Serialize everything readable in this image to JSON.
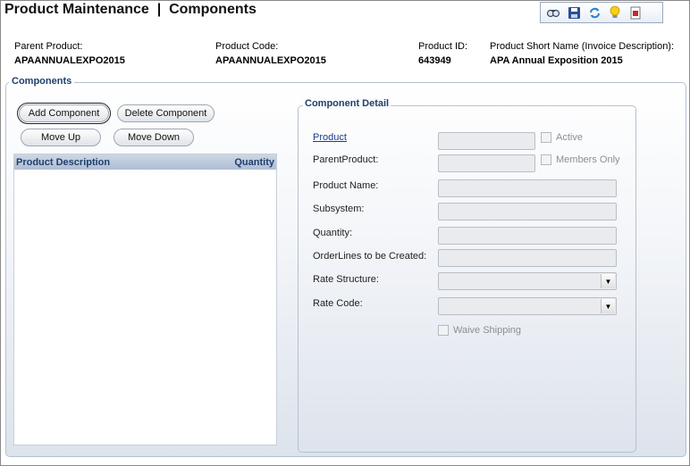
{
  "title": "Product Maintenance  |  Components",
  "toolbar": {
    "icons": [
      "find-icon",
      "save-icon",
      "refresh-icon",
      "help-bulb-icon",
      "report-icon"
    ]
  },
  "header": {
    "parent_product_label": "Parent Product:",
    "parent_product_value": "APAANNUALEXPO2015",
    "product_code_label": "Product Code:",
    "product_code_value": "APAANNUALEXPO2015",
    "product_id_label": "Product ID:",
    "product_id_value": "643949",
    "short_name_label": "Product Short Name (Invoice Description):",
    "short_name_value": "APA Annual Exposition 2015"
  },
  "components": {
    "legend": "Components",
    "add_label": "Add Component",
    "delete_label": "Delete Component",
    "move_up_label": "Move Up",
    "move_down_label": "Move Down",
    "columns": [
      "Product Description",
      "Quantity"
    ],
    "rows": []
  },
  "detail": {
    "legend": "Component Detail",
    "product_label": "Product",
    "parent_product_label": "ParentProduct:",
    "product_name_label": "Product Name:",
    "subsystem_label": "Subsystem:",
    "quantity_label": "Quantity:",
    "orderlines_label": "OrderLines to be Created:",
    "rate_structure_label": "Rate Structure:",
    "rate_code_label": "Rate Code:",
    "active_label": "Active",
    "members_only_label": "Members Only",
    "waive_shipping_label": "Waive Shipping"
  }
}
